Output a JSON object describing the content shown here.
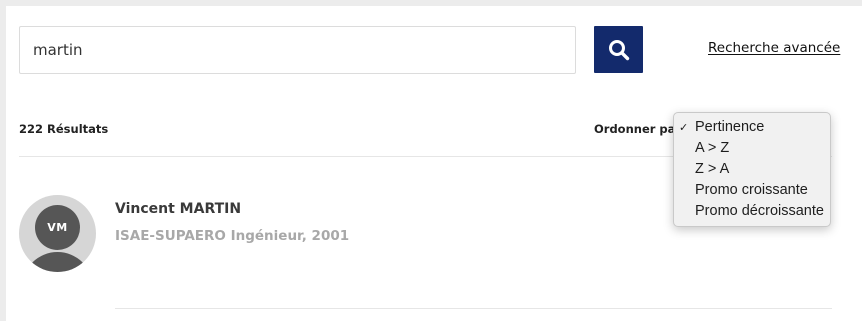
{
  "search": {
    "value": "martin",
    "placeholder": "",
    "button_icon": "search-icon",
    "advanced_link": "Recherche avancée"
  },
  "results": {
    "count_label": "222 Résultats",
    "sort_label": "Ordonner par",
    "items": [
      {
        "initials": "VM",
        "name": "Vincent MARTIN",
        "meta": "ISAE-SUPAERO Ingénieur, 2001"
      }
    ]
  },
  "sort_menu": {
    "selected_mark": "✓",
    "options": [
      "Pertinence",
      "A > Z",
      "Z > A",
      "Promo croissante",
      "Promo décroissante"
    ],
    "selected_index": 0
  },
  "colors": {
    "accent": "#132a6c",
    "page_bg": "#ececec",
    "avatar_bg": "#d6d6d6",
    "avatar_fg": "#565656",
    "muted_text": "#a8a8a8"
  }
}
